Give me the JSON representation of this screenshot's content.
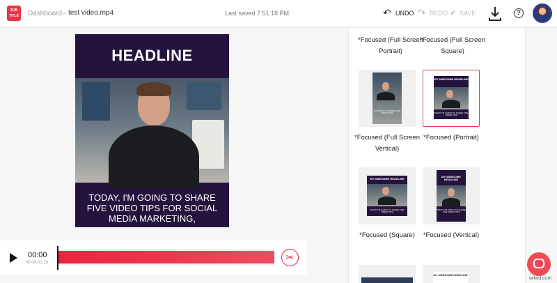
{
  "header": {
    "logo_text": "ZUB TITLE",
    "breadcrumb": "Dashboard",
    "breadcrumb_sep": "→",
    "filename": "test video.mp4",
    "last_saved": "Last saved 7:51:18 PM",
    "undo_label": "UNDO",
    "redo_label": "REDO",
    "save_label": "SAVE",
    "help_label": "?"
  },
  "preview": {
    "headline": "HEADLINE",
    "caption": "TODAY, I'M GOING TO SHARE FIVE VIDEO TIPS FOR SOCIAL MEDIA MARKETING,"
  },
  "timeline": {
    "current_time": "00:00",
    "range": "00:00-01:23",
    "progress": 1.0
  },
  "templates": [
    {
      "label": "*Focused (Full Screen Portrait)"
    },
    {
      "label": "*Focused (Full Screen Square)"
    },
    {
      "label": "*Focused (Full Screen Vertical)",
      "thumb_caption": "I'M GOING TO SHARE FIVE VIDEO TIPS"
    },
    {
      "label": "*Focused (Portrait)",
      "thumb_headline": "MY AWESOME HEADLINE",
      "thumb_caption": "TODAY I'M GOING TO SHARE FIVE VIDEO TIPS",
      "selected": true
    },
    {
      "label": "*Focused (Square)",
      "thumb_headline": "MY AWESOME HEADLINE",
      "thumb_caption": "TODAY I'M GOING TO SHARE FIVE VIDEO TIPS"
    },
    {
      "label": "*Focused (Vertical)",
      "thumb_headline": "MY AWESOME HEADLINE",
      "thumb_caption": "TODAY I'M GOING TO SHARE FIVE VIDEO TIPS"
    },
    {
      "thumb_headline": "MY AWESOME HEADLINE"
    }
  ],
  "watermark": "wikiid.com",
  "colors": {
    "accent": "#e8243d",
    "preview_bg": "#24143d"
  }
}
